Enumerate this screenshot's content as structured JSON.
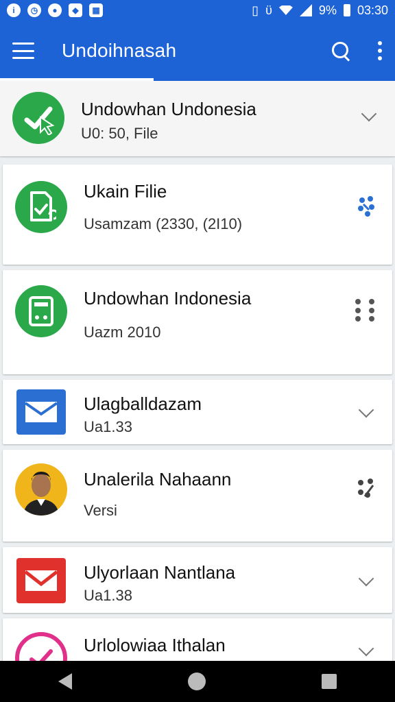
{
  "status_bar": {
    "battery_text": "%",
    "battery_level": "9",
    "time": "03:30"
  },
  "app_bar": {
    "title": "Undoihnasah"
  },
  "items": [
    {
      "title": "Undowhan Undonesia",
      "subtitle": "U0: 50, File",
      "icon": "checkmark-cursor-icon",
      "trailing": "chevron-down-icon"
    },
    {
      "title": "Ukain Filie",
      "subtitle": "Usamzam (2330, (2I10)",
      "icon": "document-check-icon",
      "trailing": "drag-handle-icon"
    },
    {
      "title": "Undowhan Indonesia",
      "subtitle": "Uazm 2010",
      "icon": "calculator-icon",
      "trailing": "drag-handle-icon"
    },
    {
      "title": "Ulagballdazam",
      "subtitle": "Ua1.33",
      "icon": "mail-icon",
      "trailing": "chevron-down-icon"
    },
    {
      "title": "Unalerila Nahaann",
      "subtitle": "Versi",
      "icon": "avatar-photo",
      "trailing": "drag-handle-icon"
    },
    {
      "title": "Ulyorlaan Nantlana",
      "subtitle": "Ua1.38",
      "icon": "mail-icon",
      "trailing": "chevron-down-icon"
    },
    {
      "title": "Urlolowiaa Ithalan",
      "subtitle": "",
      "icon": "checkmark-icon",
      "trailing": "chevron-down-icon"
    }
  ],
  "colors": {
    "primary": "#1e63d6",
    "green": "#2aa84a",
    "blue_mail": "#2a6fd1",
    "red_mail": "#e0312d",
    "pink": "#e0308a"
  }
}
